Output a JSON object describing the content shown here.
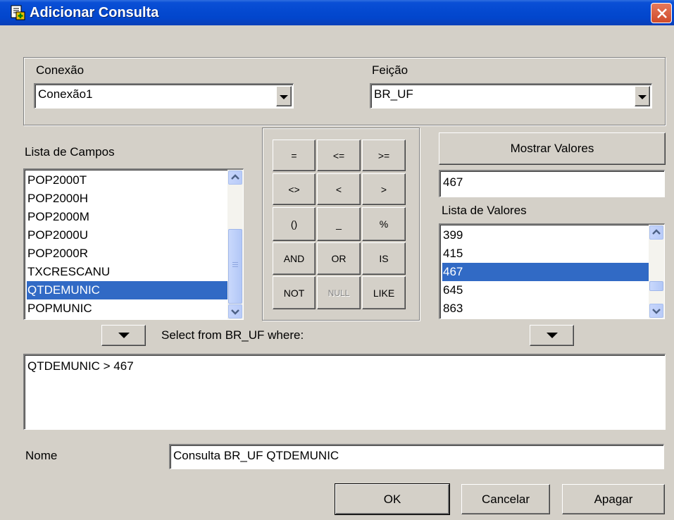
{
  "window": {
    "title": "Adicionar Consulta"
  },
  "connection": {
    "label": "Conexão",
    "value": "Conexão1"
  },
  "feature": {
    "label": "Feição",
    "value": "BR_UF"
  },
  "fields": {
    "label": "Lista de Campos",
    "items": [
      "POP2000T",
      "POP2000H",
      "POP2000M",
      "POP2000U",
      "POP2000R",
      "TXCRESCANU",
      "QTDEMUNIC",
      "POPMUNIC"
    ],
    "selected_index": 6
  },
  "operators": {
    "rows": [
      [
        "=",
        "<=",
        ">="
      ],
      [
        "<>",
        "<",
        ">"
      ],
      [
        "()",
        "_",
        "%"
      ],
      [
        "AND",
        "OR",
        "IS"
      ],
      [
        "NOT",
        "NULL",
        "LIKE"
      ]
    ],
    "disabled": [
      "NULL"
    ]
  },
  "values": {
    "show_button": "Mostrar Valores",
    "current_value": "467",
    "list_label": "Lista de Valores",
    "items": [
      "399",
      "415",
      "467",
      "645",
      "863"
    ],
    "selected_index": 2
  },
  "query": {
    "prefix": "Select from BR_UF where:",
    "text": "QTDEMUNIC > 467"
  },
  "name": {
    "label": "Nome",
    "value": "Consulta BR_UF QTDEMUNIC"
  },
  "buttons": {
    "ok": "OK",
    "cancel": "Cancelar",
    "clear": "Apagar"
  },
  "colors": {
    "titlebar": "#0449d0",
    "selection": "#316ac5",
    "face": "#d4d0c8"
  }
}
